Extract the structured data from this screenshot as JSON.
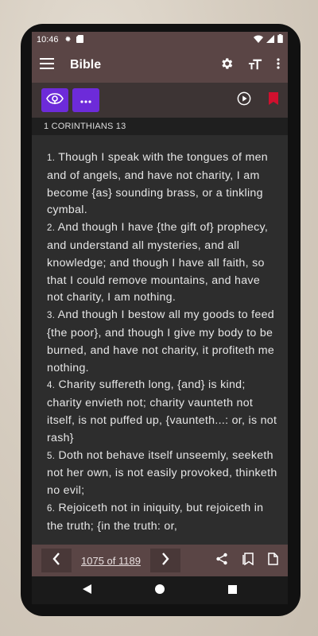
{
  "status": {
    "time": "10:46"
  },
  "appbar": {
    "title": "Bible"
  },
  "chapter": {
    "label": "1 CORINTHIANS 13"
  },
  "verses": [
    {
      "num": "1.",
      "text": "Though I speak with the tongues of men and of angels, and have not charity, I am become {as} sounding brass, or a tinkling cymbal."
    },
    {
      "num": "2.",
      "text": "And though I have {the gift of} prophecy, and understand all mysteries, and all knowledge; and though I have all faith, so that I could remove mountains, and have not charity, I am nothing."
    },
    {
      "num": "3.",
      "text": "And though I bestow all my goods to feed {the poor}, and though I give my body to be burned, and have not charity, it profiteth me nothing."
    },
    {
      "num": "4.",
      "text": "Charity suffereth long, {and} is kind; charity envieth not; charity vaunteth not itself, is not puffed up, {vaunteth...: or, is not rash}"
    },
    {
      "num": "5.",
      "text": "Doth not behave itself unseemly, seeketh not her own, is not easily provoked, thinketh no evil;"
    },
    {
      "num": "6.",
      "text": "Rejoiceth not in iniquity, but rejoiceth in the truth; {in the truth: or,"
    }
  ],
  "pager": {
    "label": "1075 of 1189"
  },
  "colors": {
    "appbar": "#5a4545",
    "accent": "#6d2bd9",
    "bookmark": "#d0102e"
  }
}
